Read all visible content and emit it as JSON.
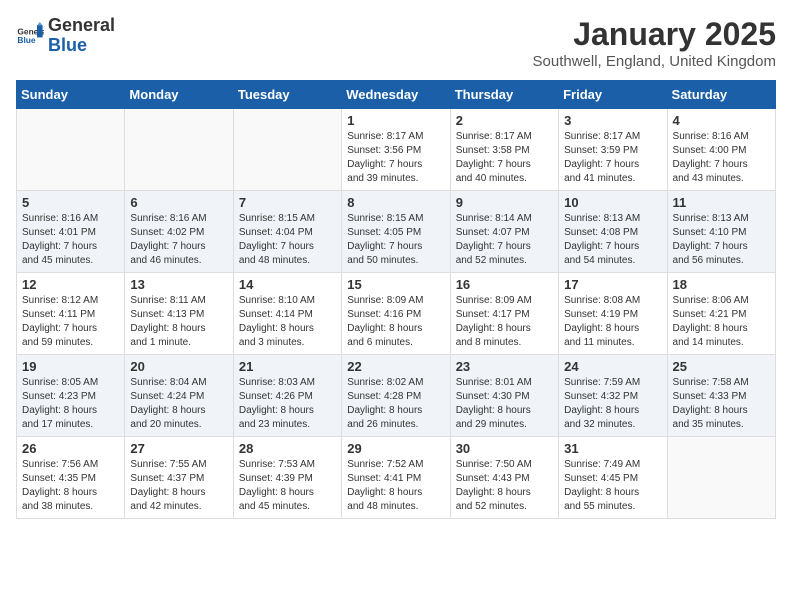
{
  "header": {
    "logo_general": "General",
    "logo_blue": "Blue",
    "month_title": "January 2025",
    "location": "Southwell, England, United Kingdom"
  },
  "weekdays": [
    "Sunday",
    "Monday",
    "Tuesday",
    "Wednesday",
    "Thursday",
    "Friday",
    "Saturday"
  ],
  "weeks": [
    [
      {
        "day": "",
        "info": ""
      },
      {
        "day": "",
        "info": ""
      },
      {
        "day": "",
        "info": ""
      },
      {
        "day": "1",
        "info": "Sunrise: 8:17 AM\nSunset: 3:56 PM\nDaylight: 7 hours\nand 39 minutes."
      },
      {
        "day": "2",
        "info": "Sunrise: 8:17 AM\nSunset: 3:58 PM\nDaylight: 7 hours\nand 40 minutes."
      },
      {
        "day": "3",
        "info": "Sunrise: 8:17 AM\nSunset: 3:59 PM\nDaylight: 7 hours\nand 41 minutes."
      },
      {
        "day": "4",
        "info": "Sunrise: 8:16 AM\nSunset: 4:00 PM\nDaylight: 7 hours\nand 43 minutes."
      }
    ],
    [
      {
        "day": "5",
        "info": "Sunrise: 8:16 AM\nSunset: 4:01 PM\nDaylight: 7 hours\nand 45 minutes."
      },
      {
        "day": "6",
        "info": "Sunrise: 8:16 AM\nSunset: 4:02 PM\nDaylight: 7 hours\nand 46 minutes."
      },
      {
        "day": "7",
        "info": "Sunrise: 8:15 AM\nSunset: 4:04 PM\nDaylight: 7 hours\nand 48 minutes."
      },
      {
        "day": "8",
        "info": "Sunrise: 8:15 AM\nSunset: 4:05 PM\nDaylight: 7 hours\nand 50 minutes."
      },
      {
        "day": "9",
        "info": "Sunrise: 8:14 AM\nSunset: 4:07 PM\nDaylight: 7 hours\nand 52 minutes."
      },
      {
        "day": "10",
        "info": "Sunrise: 8:13 AM\nSunset: 4:08 PM\nDaylight: 7 hours\nand 54 minutes."
      },
      {
        "day": "11",
        "info": "Sunrise: 8:13 AM\nSunset: 4:10 PM\nDaylight: 7 hours\nand 56 minutes."
      }
    ],
    [
      {
        "day": "12",
        "info": "Sunrise: 8:12 AM\nSunset: 4:11 PM\nDaylight: 7 hours\nand 59 minutes."
      },
      {
        "day": "13",
        "info": "Sunrise: 8:11 AM\nSunset: 4:13 PM\nDaylight: 8 hours\nand 1 minute."
      },
      {
        "day": "14",
        "info": "Sunrise: 8:10 AM\nSunset: 4:14 PM\nDaylight: 8 hours\nand 3 minutes."
      },
      {
        "day": "15",
        "info": "Sunrise: 8:09 AM\nSunset: 4:16 PM\nDaylight: 8 hours\nand 6 minutes."
      },
      {
        "day": "16",
        "info": "Sunrise: 8:09 AM\nSunset: 4:17 PM\nDaylight: 8 hours\nand 8 minutes."
      },
      {
        "day": "17",
        "info": "Sunrise: 8:08 AM\nSunset: 4:19 PM\nDaylight: 8 hours\nand 11 minutes."
      },
      {
        "day": "18",
        "info": "Sunrise: 8:06 AM\nSunset: 4:21 PM\nDaylight: 8 hours\nand 14 minutes."
      }
    ],
    [
      {
        "day": "19",
        "info": "Sunrise: 8:05 AM\nSunset: 4:23 PM\nDaylight: 8 hours\nand 17 minutes."
      },
      {
        "day": "20",
        "info": "Sunrise: 8:04 AM\nSunset: 4:24 PM\nDaylight: 8 hours\nand 20 minutes."
      },
      {
        "day": "21",
        "info": "Sunrise: 8:03 AM\nSunset: 4:26 PM\nDaylight: 8 hours\nand 23 minutes."
      },
      {
        "day": "22",
        "info": "Sunrise: 8:02 AM\nSunset: 4:28 PM\nDaylight: 8 hours\nand 26 minutes."
      },
      {
        "day": "23",
        "info": "Sunrise: 8:01 AM\nSunset: 4:30 PM\nDaylight: 8 hours\nand 29 minutes."
      },
      {
        "day": "24",
        "info": "Sunrise: 7:59 AM\nSunset: 4:32 PM\nDaylight: 8 hours\nand 32 minutes."
      },
      {
        "day": "25",
        "info": "Sunrise: 7:58 AM\nSunset: 4:33 PM\nDaylight: 8 hours\nand 35 minutes."
      }
    ],
    [
      {
        "day": "26",
        "info": "Sunrise: 7:56 AM\nSunset: 4:35 PM\nDaylight: 8 hours\nand 38 minutes."
      },
      {
        "day": "27",
        "info": "Sunrise: 7:55 AM\nSunset: 4:37 PM\nDaylight: 8 hours\nand 42 minutes."
      },
      {
        "day": "28",
        "info": "Sunrise: 7:53 AM\nSunset: 4:39 PM\nDaylight: 8 hours\nand 45 minutes."
      },
      {
        "day": "29",
        "info": "Sunrise: 7:52 AM\nSunset: 4:41 PM\nDaylight: 8 hours\nand 48 minutes."
      },
      {
        "day": "30",
        "info": "Sunrise: 7:50 AM\nSunset: 4:43 PM\nDaylight: 8 hours\nand 52 minutes."
      },
      {
        "day": "31",
        "info": "Sunrise: 7:49 AM\nSunset: 4:45 PM\nDaylight: 8 hours\nand 55 minutes."
      },
      {
        "day": "",
        "info": ""
      }
    ]
  ]
}
